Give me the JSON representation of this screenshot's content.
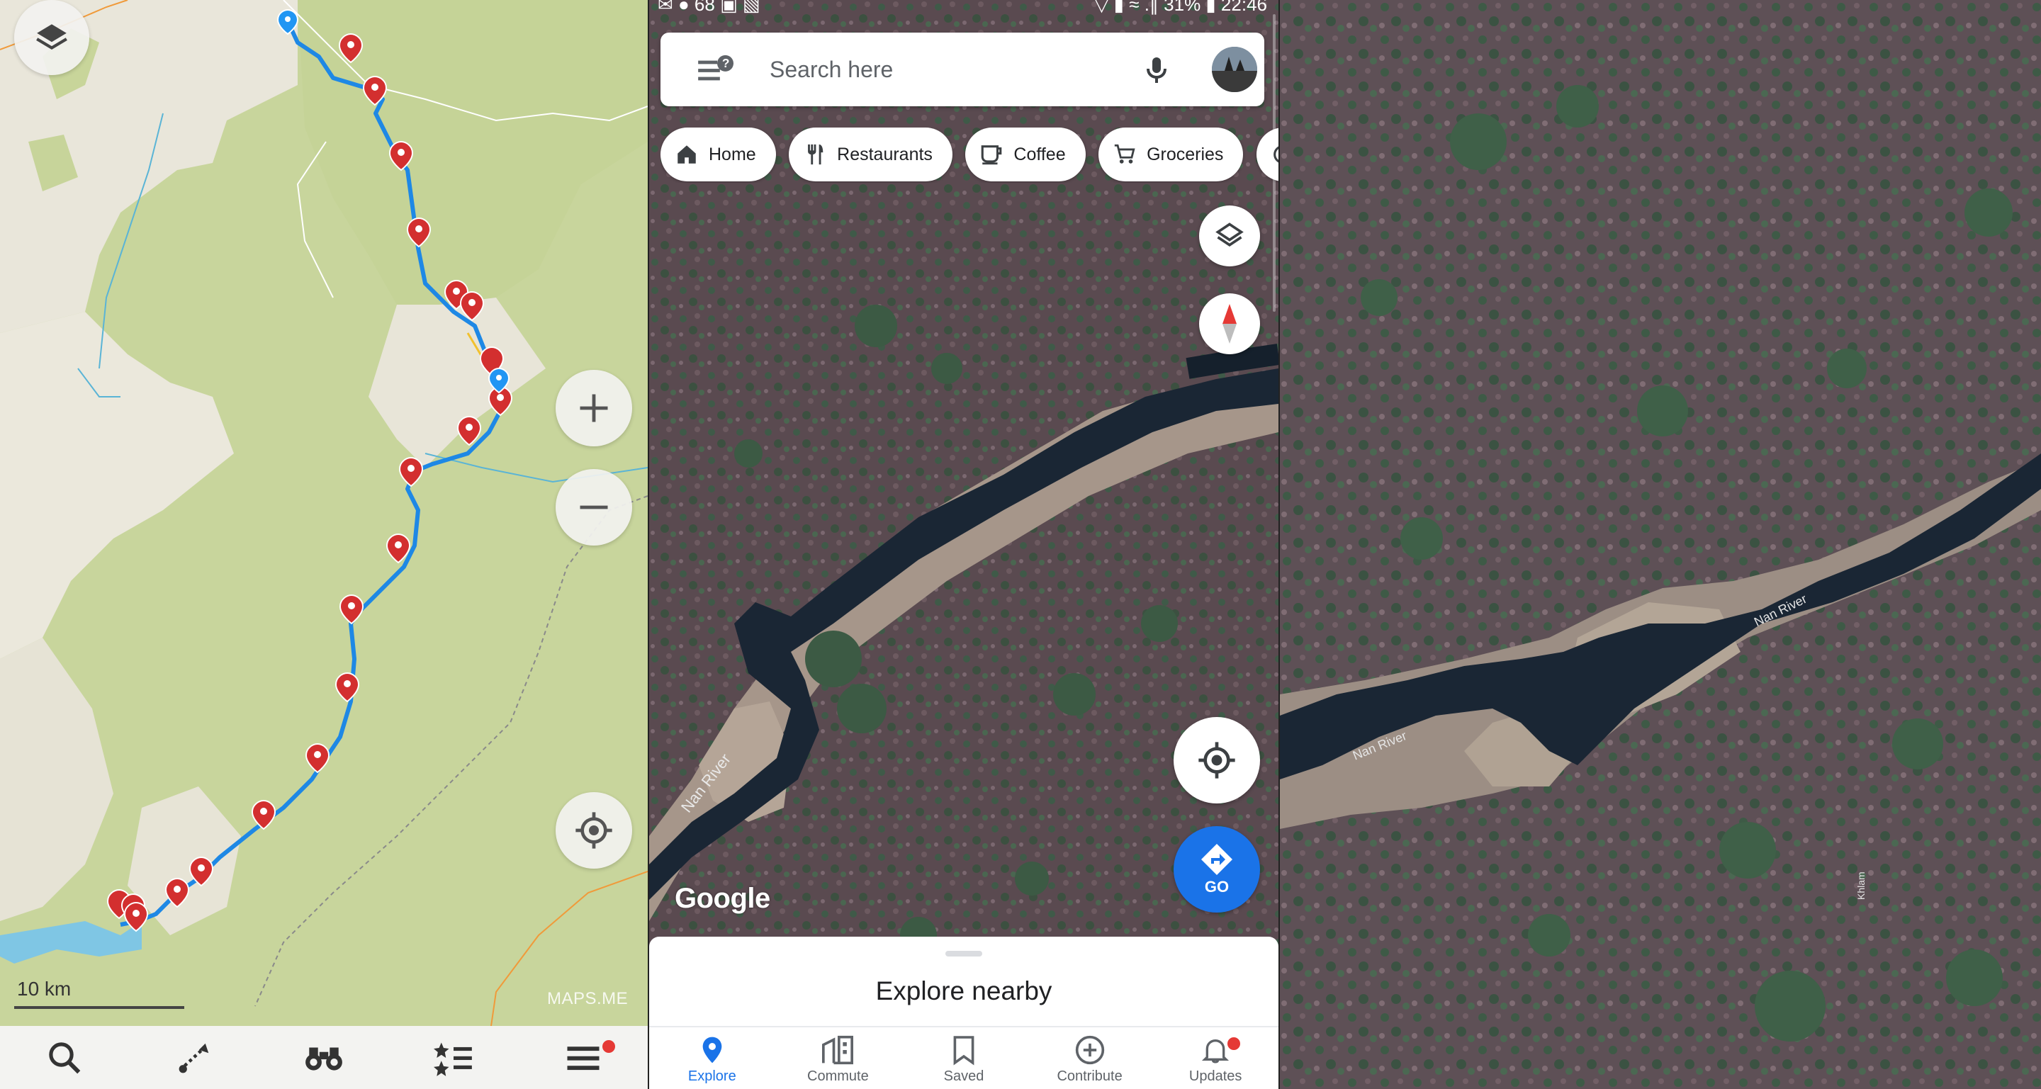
{
  "maps_me": {
    "scale_label": "10 km",
    "watermark": "MAPS.ME",
    "bottom_tabs": [
      "search-icon",
      "route-icon",
      "discovery-icon",
      "bookmarks-icon",
      "menu-icon"
    ],
    "accent_color": "#1e88e5",
    "pin_color": "#d32f2f"
  },
  "google_maps": {
    "status_bar": {
      "left": "✉ ● 68 ▣ ▧",
      "right": "▽ ▮ ≈ .∥ 31% ▮ 22:46"
    },
    "search": {
      "placeholder": "Search here"
    },
    "chips": [
      {
        "label": "Home",
        "icon": "home-icon"
      },
      {
        "label": "Restaurants",
        "icon": "restaurant-icon"
      },
      {
        "label": "Coffee",
        "icon": "coffee-icon"
      },
      {
        "label": "Groceries",
        "icon": "cart-icon"
      }
    ],
    "go_label": "GO",
    "logo": "Google",
    "river_label": "Nan River",
    "sheet_title": "Explore nearby",
    "nav": [
      {
        "label": "Explore",
        "icon": "explore-pin-icon",
        "active": true
      },
      {
        "label": "Commute",
        "icon": "commute-icon",
        "active": false
      },
      {
        "label": "Saved",
        "icon": "bookmark-icon",
        "active": false
      },
      {
        "label": "Contribute",
        "icon": "plus-circle-icon",
        "active": false
      },
      {
        "label": "Updates",
        "icon": "bell-icon",
        "active": false
      }
    ],
    "accent_color": "#1a73e8"
  },
  "satellite": {
    "river_labels": [
      "Nan River",
      "Nan River"
    ],
    "small_label": "Khlam"
  }
}
